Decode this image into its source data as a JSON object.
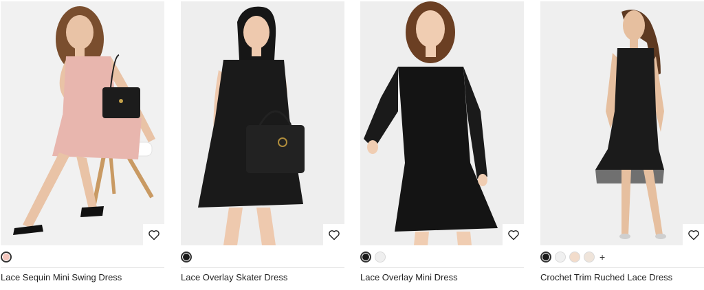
{
  "products": [
    {
      "title": "Lace Sequin Mini Swing Dress",
      "photo_bg": "#f1f1f1",
      "dress_color": "#e8b6ae",
      "swatches": [
        "#f3c4bb"
      ],
      "more": ""
    },
    {
      "title": "Lace Overlay Skater Dress",
      "photo_bg": "#eeeeee",
      "dress_color": "#1a1a1a",
      "swatches": [
        "#1a1a1a"
      ],
      "more": ""
    },
    {
      "title": "Lace Overlay Mini Dress",
      "photo_bg": "#eeeeee",
      "dress_color": "#141414",
      "swatches": [
        "#1a1a1a",
        "#efefef"
      ],
      "more": ""
    },
    {
      "title": "Crochet Trim Ruched Lace Dress",
      "photo_bg": "#efefef",
      "dress_color": "#1b1b1b",
      "swatches": [
        "#1a1a1a",
        "#f0f0f0",
        "#f2dccb",
        "#efe4da"
      ],
      "more": "+"
    }
  ],
  "icons": {
    "wishlist": "heart-outline-icon"
  }
}
